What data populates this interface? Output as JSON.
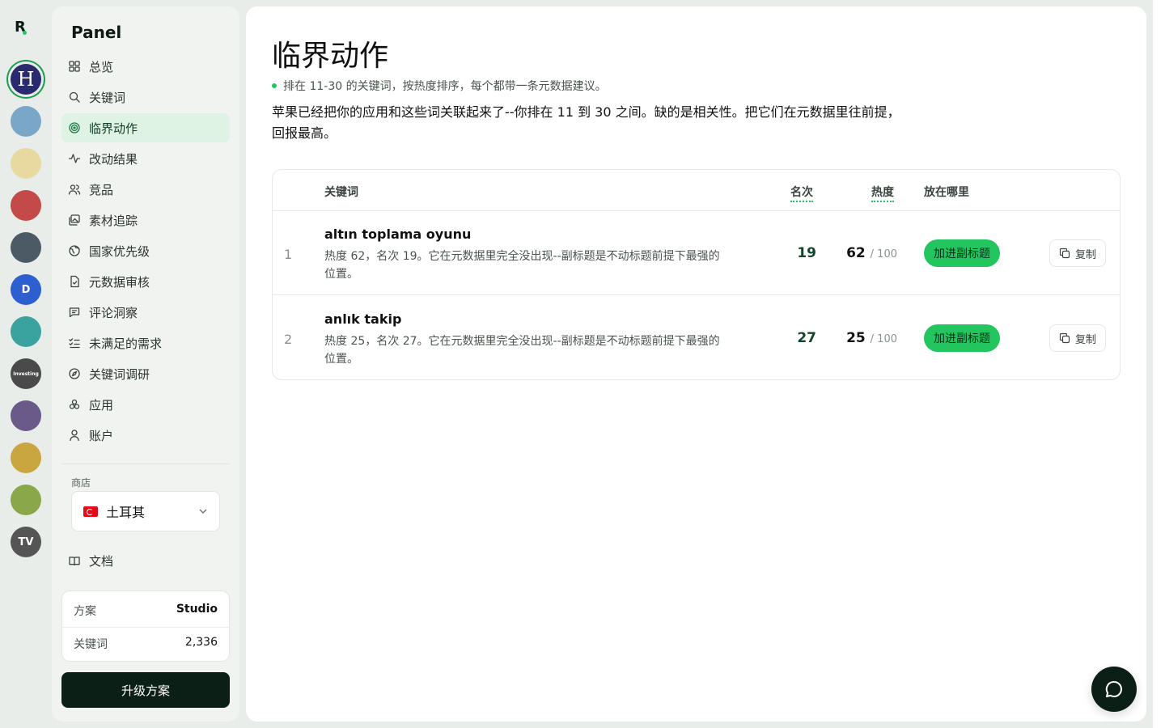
{
  "rail": {
    "apps": [
      {
        "name": "app-icon-h",
        "label": "H",
        "bg": "#2a2a6e"
      },
      {
        "name": "app-icon-subway",
        "label": "",
        "bg": "#7aa7c7"
      },
      {
        "name": "app-icon-altin",
        "label": "",
        "bg": "#e8d9a0"
      },
      {
        "name": "app-icon-blocks",
        "label": "",
        "bg": "#c44a4a"
      },
      {
        "name": "app-icon-chart",
        "label": "",
        "bg": "#4c5a66"
      },
      {
        "name": "app-icon-d",
        "label": "D",
        "bg": "#2e5fd0"
      },
      {
        "name": "app-icon-ticket",
        "label": "",
        "bg": "#3aa3a0"
      },
      {
        "name": "app-icon-investing",
        "label": "Investing",
        "bg": "#4a4a4a"
      },
      {
        "name": "app-icon-game",
        "label": "",
        "bg": "#6a5a8a"
      },
      {
        "name": "app-icon-temple-1",
        "label": "",
        "bg": "#c9a640"
      },
      {
        "name": "app-icon-temple-2",
        "label": "",
        "bg": "#8aa84a"
      },
      {
        "name": "app-icon-tv",
        "label": "TV",
        "bg": "#555"
      }
    ]
  },
  "sidebar": {
    "brand": "Panel",
    "items": [
      {
        "label": "总览",
        "icon": "grid-icon"
      },
      {
        "label": "关键词",
        "icon": "search-icon"
      },
      {
        "label": "临界动作",
        "icon": "target-icon",
        "active": true
      },
      {
        "label": "改动结果",
        "icon": "activity-icon"
      },
      {
        "label": "竞品",
        "icon": "users-icon"
      },
      {
        "label": "素材追踪",
        "icon": "images-icon"
      },
      {
        "label": "国家优先级",
        "icon": "globe-icon"
      },
      {
        "label": "元数据审核",
        "icon": "file-check-icon"
      },
      {
        "label": "评论洞察",
        "icon": "message-icon"
      },
      {
        "label": "未满足的需求",
        "icon": "list-check-icon"
      },
      {
        "label": "关键词调研",
        "icon": "compass-icon"
      },
      {
        "label": "应用",
        "icon": "apps-icon"
      },
      {
        "label": "账户",
        "icon": "user-icon"
      }
    ],
    "store_label": "商店",
    "store_value": "土耳其",
    "docs_label": "文档",
    "plan": {
      "label": "方案",
      "value": "Studio"
    },
    "keywords": {
      "label": "关键词",
      "value": "2,336"
    },
    "upgrade_label": "升级方案"
  },
  "main": {
    "title": "临界动作",
    "subtitle": "排在 11-30 的关键词，按热度排序，每个都带一条元数据建议。",
    "description": "苹果已经把你的应用和这些词关联起来了--你排在 11 到 30 之间。缺的是相关性。把它们在元数据里往前提，回报最高。",
    "table": {
      "headers": {
        "keyword": "关键词",
        "rank": "名次",
        "heat": "热度",
        "where": "放在哪里"
      },
      "rows": [
        {
          "index": "1",
          "keyword": "altın toplama oyunu",
          "note": "热度 62，名次 19。它在元数据里完全没出现--副标题是不动标题前提下最强的位置。",
          "rank": "19",
          "heat": "62",
          "heat_max": "/ 100",
          "action": "加进副标题",
          "copy": "复制"
        },
        {
          "index": "2",
          "keyword": "anlık takip",
          "note": "热度 25，名次 27。它在元数据里完全没出现--副标题是不动标题前提下最强的位置。",
          "rank": "27",
          "heat": "25",
          "heat_max": "/ 100",
          "action": "加进副标题",
          "copy": "复制"
        }
      ]
    }
  },
  "colors": {
    "accent": "#22c55e",
    "dark": "#0c1f16",
    "active_bg": "#dff3e4"
  }
}
